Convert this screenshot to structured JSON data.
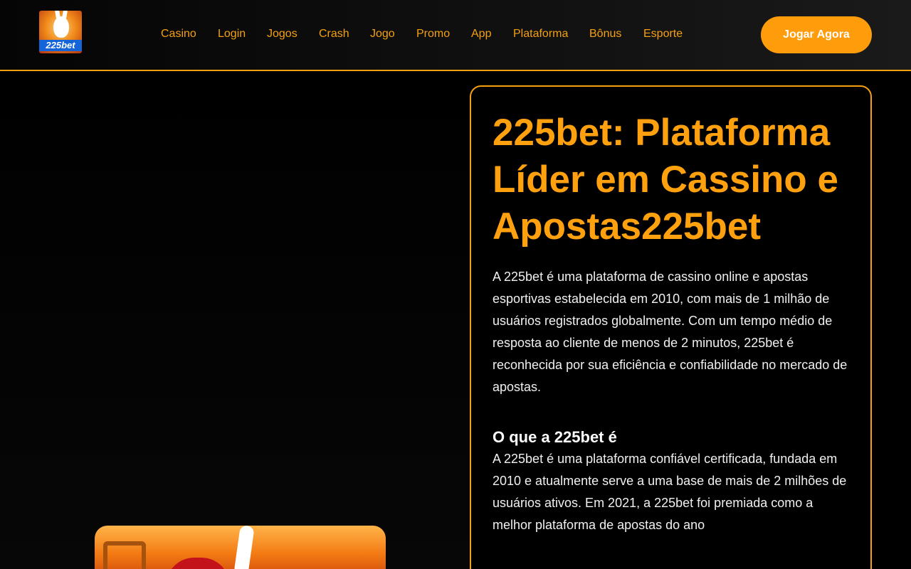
{
  "header": {
    "logo_text": "225bet",
    "nav": [
      "Casino",
      "Login",
      "Jogos",
      "Crash",
      "Jogo",
      "Promo",
      "App",
      "Plataforma",
      "Bônus",
      "Esporte"
    ],
    "cta_label": "Jogar Agora"
  },
  "main": {
    "title": "225bet: Plataforma Líder em Cassino e Apostas225bet",
    "intro": "A 225bet é uma plataforma de cassino online e apostas esportivas estabelecida em 2010, com mais de 1 milhão de usuários registrados globalmente. Com um tempo médio de resposta ao cliente de menos de 2 minutos, 225bet é reconhecida por sua eficiência e confiabilidade no mercado de apostas.",
    "section_heading": "O que a 225bet é",
    "section_text": "A 225bet é uma plataforma confiável certificada, fundada em 2010 e atualmente serve a uma base de mais de 2 milhões de usuários ativos. Em 2021, a 225bet foi premiada como a melhor plataforma de apostas do ano"
  },
  "colors": {
    "accent": "#f5a00f",
    "cta": "#ff9c0c",
    "background": "#000000"
  }
}
